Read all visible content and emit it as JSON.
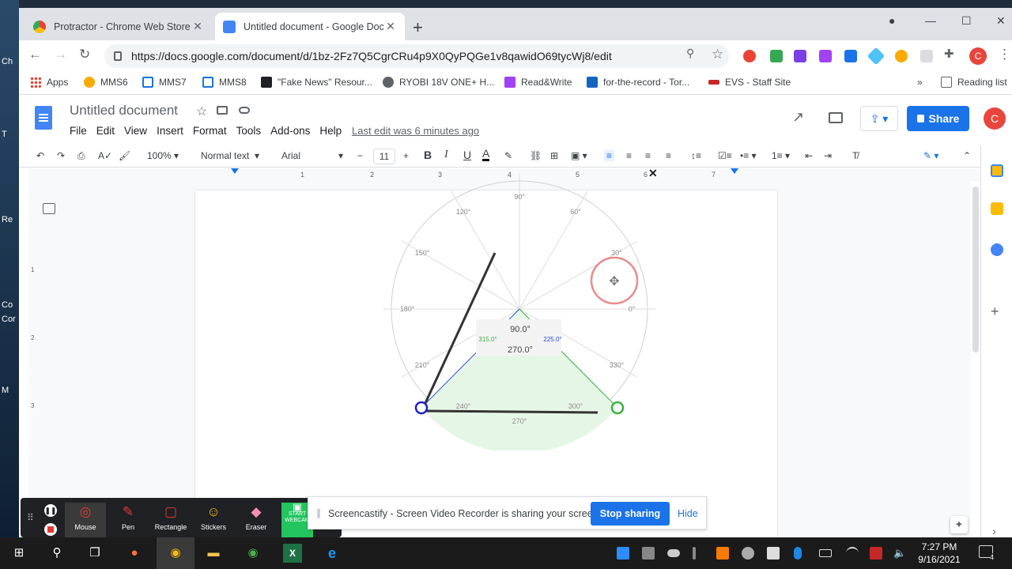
{
  "desktop": {
    "labels": [
      "Ch",
      "T",
      "Re",
      "Co",
      "Cor",
      "M"
    ]
  },
  "browser": {
    "tabs": [
      {
        "title": "Protractor - Chrome Web Store",
        "active": false
      },
      {
        "title": "Untitled document - Google Doc",
        "active": true
      }
    ],
    "new_tab": "+",
    "url": "https://docs.google.com/document/d/1bz-2Fz7Q5CgrCRu4p9X0QyPQGe1v8qawidO69tycWj8/edit",
    "profile_initial": "C",
    "bookmarks": [
      "Apps",
      "MMS6",
      "MMS7",
      "MMS8",
      "\"Fake News\" Resour...",
      "RYOBI 18V ONE+ H...",
      "Read&Write",
      "for-the-record - Tor...",
      "EVS - Staff Site"
    ],
    "reading_list": "Reading list",
    "more_bookmarks": "»"
  },
  "docs": {
    "title": "Untitled document",
    "menu": [
      "File",
      "Edit",
      "View",
      "Insert",
      "Format",
      "Tools",
      "Add-ons",
      "Help"
    ],
    "last_edit": "Last edit was 6 minutes ago",
    "share": "Share",
    "user_initial": "C",
    "toolbar": {
      "zoom": "100%",
      "style": "Normal text",
      "font": "Arial",
      "size": "11"
    },
    "ruler": [
      "1",
      "2",
      "3",
      "4",
      "5",
      "6",
      "7"
    ],
    "ruler_left": [
      "1",
      "2",
      "3"
    ]
  },
  "protractor": {
    "degree_labels": [
      "90°",
      "60°",
      "30°",
      "0°",
      "330°",
      "300°",
      "270°",
      "240°",
      "210°",
      "180°",
      "150°",
      "120°"
    ],
    "readouts": {
      "main": "90.0°",
      "reflex": "270.0°",
      "left": "315.0°",
      "right": "225.0°"
    }
  },
  "screencastify": {
    "tools": [
      "Mouse",
      "Pen",
      "Rectangle",
      "Stickers",
      "Eraser",
      "START WEBCAM"
    ],
    "banner_text": "Screencastify - Screen Video Recorder is sharing your screen.",
    "stop_sharing": "Stop sharing",
    "hide": "Hide"
  },
  "taskbar": {
    "time": "7:27 PM",
    "date": "9/16/2021",
    "notification_count": "4"
  }
}
